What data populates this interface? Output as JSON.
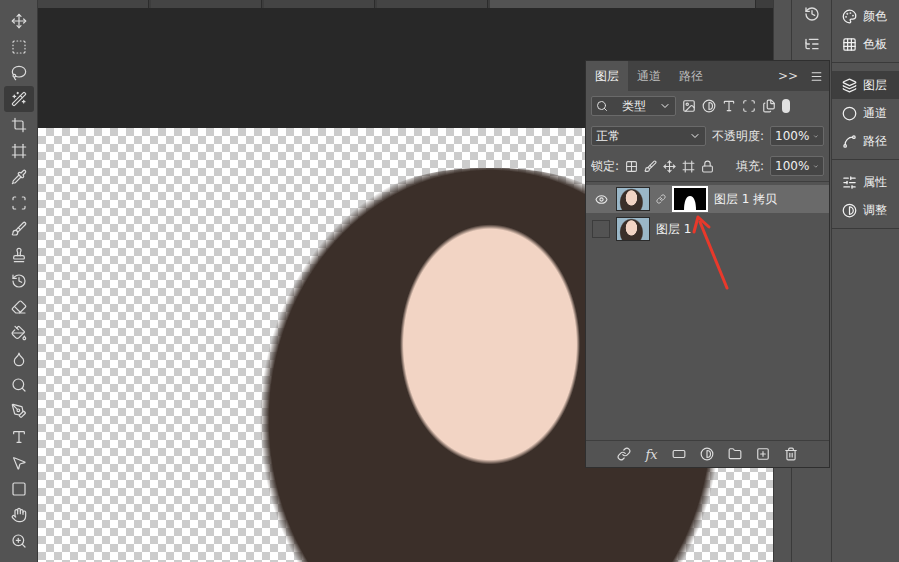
{
  "tools": [
    {
      "selected": false
    },
    {
      "selected": false
    },
    {
      "selected": false
    },
    {
      "selected": true
    },
    {
      "selected": false
    },
    {
      "selected": false
    },
    {
      "selected": false
    },
    {
      "selected": false
    },
    {
      "selected": false
    },
    {
      "selected": false
    },
    {
      "selected": false
    },
    {
      "selected": false
    },
    {
      "selected": false
    },
    {
      "selected": false
    },
    {
      "selected": false
    },
    {
      "selected": false
    },
    {
      "selected": false
    },
    {
      "selected": false
    },
    {
      "selected": false
    },
    {
      "selected": false
    },
    {
      "selected": false
    }
  ],
  "dock_groups": [
    {
      "items": [
        {
          "label": "颜色",
          "selected": false
        },
        {
          "label": "色板",
          "selected": false
        }
      ]
    },
    {
      "items": [
        {
          "label": "图层",
          "selected": true
        },
        {
          "label": "通道",
          "selected": false
        },
        {
          "label": "路径",
          "selected": false
        }
      ]
    },
    {
      "items": [
        {
          "label": "属性",
          "selected": false
        },
        {
          "label": "调整",
          "selected": false
        }
      ]
    }
  ],
  "layers_panel": {
    "tabs": [
      {
        "label": "图层",
        "selected": true
      },
      {
        "label": "通道",
        "selected": false
      },
      {
        "label": "路径",
        "selected": false
      }
    ],
    "overflow": ">>",
    "filter_kind": "类型",
    "blend_mode": "正常",
    "opacity_label": "不透明度:",
    "opacity": "100%",
    "lock_label": "锁定:",
    "fill_label": "填充:",
    "fill": "100%",
    "layers": [
      {
        "name": "图层 1 拷贝",
        "visible": true,
        "selected": true,
        "has_mask": true
      },
      {
        "name": "图层 1",
        "visible": false,
        "selected": false,
        "has_mask": false
      }
    ],
    "effects_label": "fx"
  }
}
